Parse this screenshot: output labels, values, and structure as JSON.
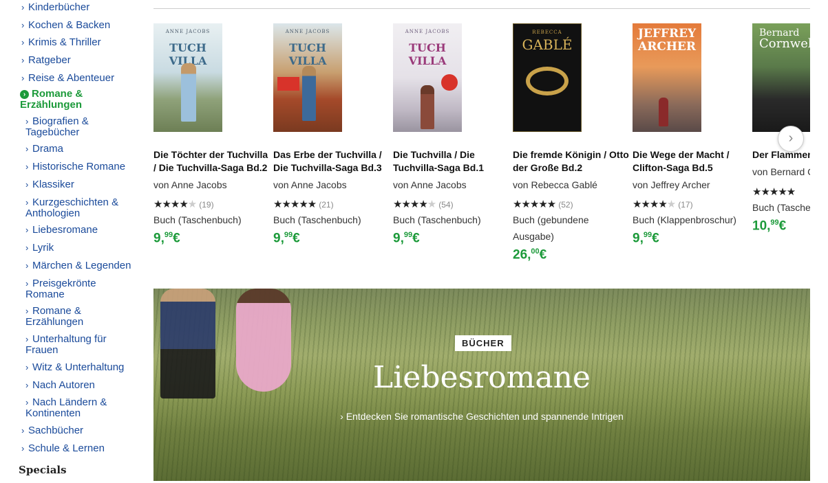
{
  "sidebar": {
    "items": [
      {
        "label": "Kinderbücher"
      },
      {
        "label": "Kochen & Backen"
      },
      {
        "label": "Krimis & Thriller"
      },
      {
        "label": "Ratgeber"
      },
      {
        "label": "Reise & Abenteuer"
      },
      {
        "label": "Romane & Erzählungen"
      },
      {
        "label": "Biografien & Tagebücher"
      },
      {
        "label": "Drama"
      },
      {
        "label": "Historische Romane"
      },
      {
        "label": "Klassiker"
      },
      {
        "label": "Kurzgeschichten & Anthologien"
      },
      {
        "label": "Liebesromane"
      },
      {
        "label": "Lyrik"
      },
      {
        "label": "Märchen & Legenden"
      },
      {
        "label": "Preisgekrönte Romane"
      },
      {
        "label": "Romane & Erzählungen"
      },
      {
        "label": "Unterhaltung für Frauen"
      },
      {
        "label": "Witz & Unterhaltung"
      },
      {
        "label": "Nach Autoren"
      },
      {
        "label": "Nach Ländern & Kontinenten"
      },
      {
        "label": "Sachbücher"
      },
      {
        "label": "Schule & Lernen"
      }
    ],
    "specials": "Specials"
  },
  "products": [
    {
      "cover_author": "ANNE JACOBS",
      "cover_title": "TUCH VILLA",
      "title": "Die Töchter der Tuchvilla / Die Tuchvilla-Saga Bd.2",
      "author": "von Anne Jacobs",
      "rating": 4,
      "reviews": "(19)",
      "format": "Buch (Taschenbuch)",
      "price_main": "9,",
      "price_cents": "99",
      "currency": "€"
    },
    {
      "cover_author": "ANNE JACOBS",
      "cover_title": "TUCH VILLA",
      "title": "Das Erbe der Tuchvilla / Die Tuchvilla-Saga Bd.3",
      "author": "von Anne Jacobs",
      "rating": 5,
      "reviews": "(21)",
      "format": "Buch (Taschenbuch)",
      "price_main": "9,",
      "price_cents": "99",
      "currency": "€"
    },
    {
      "cover_author": "ANNE JACOBS",
      "cover_title": "TUCH VILLA",
      "title": "Die Tuchvilla / Die Tuchvilla-Saga Bd.1",
      "author": "von Anne Jacobs",
      "rating": 4,
      "reviews": "(54)",
      "format": "Buch (Taschenbuch)",
      "price_main": "9,",
      "price_cents": "99",
      "currency": "€"
    },
    {
      "cover_author": "REBECCA",
      "cover_title": "GABLÉ",
      "title": "Die fremde Königin / Otto der Große Bd.2",
      "author": "von Rebecca Gablé",
      "rating": 5,
      "reviews": "(52)",
      "format": "Buch (gebundene Ausgabe)",
      "price_main": "26,",
      "price_cents": "00",
      "currency": "€"
    },
    {
      "cover_author": "JEFFREY",
      "cover_title": "ARCHER",
      "title": "Die Wege der Macht / Clifton-Saga Bd.5",
      "author": "von Jeffrey Archer",
      "rating": 4,
      "reviews": "(17)",
      "format": "Buch (Klappenbroschur)",
      "price_main": "9,",
      "price_cents": "99",
      "currency": "€"
    },
    {
      "cover_author": "Bernard",
      "cover_title": "Cornwell",
      "title": "Der Flammenträger",
      "author": "von Bernard Cornwell",
      "rating": 5,
      "reviews": "",
      "format": "Buch (Taschenbuch)",
      "price_main": "10,",
      "price_cents": "99",
      "currency": "€"
    }
  ],
  "carousel": {
    "next_icon": "›"
  },
  "banner": {
    "badge": "BÜCHER",
    "title": "Liebesromane",
    "subtitle": "› Entdecken Sie romantische Geschichten und spannende Intrigen"
  },
  "colors": {
    "link": "#1a4a9a",
    "accent_green": "#1c9a3a"
  }
}
